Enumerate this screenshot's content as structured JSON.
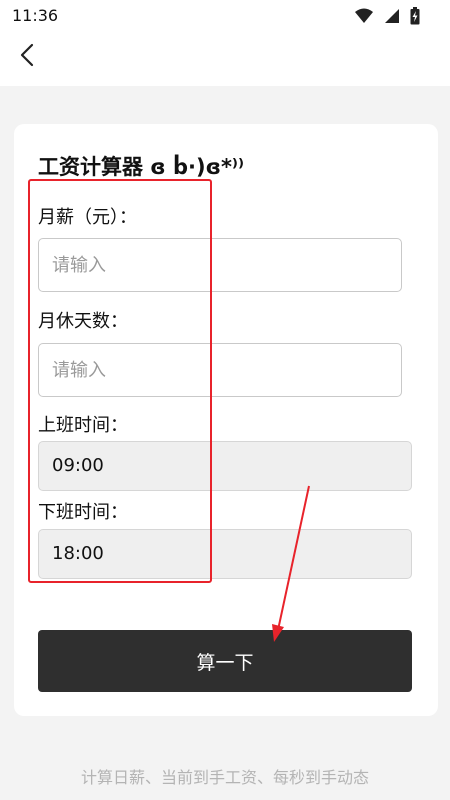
{
  "status_bar": {
    "time": "11:36",
    "icons": [
      "wifi-icon",
      "cellular-signal-icon",
      "battery-icon"
    ]
  },
  "nav": {
    "back_icon": "chevron-left-icon"
  },
  "card": {
    "title": "工资计算器 ɞ ḃ·)ɞ*⁾⁾",
    "fields": [
      {
        "label": "月薪（元）：",
        "placeholder": "请输入",
        "value": ""
      },
      {
        "label": "月休天数：",
        "placeholder": "请输入",
        "value": ""
      },
      {
        "label": "上班时间：",
        "value": "09:00"
      },
      {
        "label": "下班时间：",
        "value": "18:00"
      }
    ],
    "button_label": "算一下"
  },
  "footer": {
    "text": "计算日薪、当前到手工资、每秒到手动态"
  },
  "colors": {
    "background": "#f3f3f3",
    "card": "#ffffff",
    "button": "#2f2f2f",
    "annotation": "#e8232b",
    "footer_text": "#b4b4b4"
  }
}
